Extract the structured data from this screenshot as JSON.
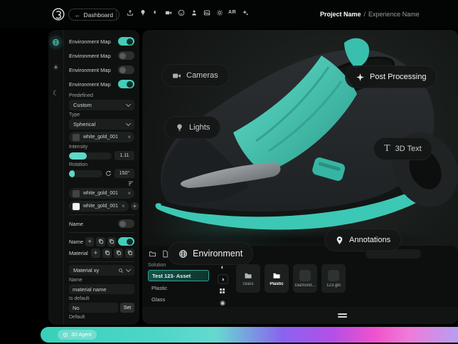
{
  "theme": {
    "accent": "#45cdb9",
    "bar_teal": "#38d0ba",
    "bar_purple": "#8a63f0",
    "bar_magenta": "#ef52cc",
    "bar_lavender": "#b79ef2"
  },
  "topbar": {
    "back": "←",
    "dashboard": "Dashboard",
    "icons": [
      "upload",
      "light-bulb",
      "contrast",
      "video-camera",
      "face",
      "person-pin",
      "image",
      "settings-gear",
      "ar",
      "magic-avatar"
    ],
    "ar_label": "AR",
    "project_name": "Project Name",
    "separator": "/",
    "experience_name": "Experience Name"
  },
  "sidebar": {
    "rail": [
      "globe",
      "sun",
      "moon"
    ],
    "env_toggles": [
      {
        "label": "Environment Map",
        "on": true
      },
      {
        "label": "Environment Map",
        "on": false
      },
      {
        "label": "Environment Map",
        "on": false
      },
      {
        "label": "Environment Map",
        "on": true
      }
    ],
    "predefined": {
      "label": "Predefined",
      "value": "Custom"
    },
    "type": {
      "label": "Type",
      "value": "Spherical"
    },
    "map_slot": {
      "name": "white_gold_001",
      "remove": "×"
    },
    "intensity": {
      "label": "Intensity",
      "value": "1.11",
      "pct": 42
    },
    "rotation": {
      "label": "Rotation",
      "value": "150°",
      "pct": 18
    },
    "map_items": [
      {
        "name": "white_gold_001",
        "remove": "×"
      },
      {
        "name": "white_gold_001",
        "remove": "×",
        "add": "+"
      }
    ],
    "name_toggle": {
      "label": "Name",
      "on": false
    },
    "name_row": {
      "label": "Name",
      "add": "+",
      "on": true
    },
    "material_row": {
      "label": "Material",
      "add": "+"
    },
    "material_select": {
      "value": "Material xy"
    },
    "material_name": {
      "label": "Name",
      "value": "material name"
    },
    "is_default": {
      "label": "Is default",
      "value": "No",
      "button": "Set"
    },
    "default_label": "Default"
  },
  "viewport": {
    "pills": [
      {
        "label": "Cameras",
        "icon": "video-camera"
      },
      {
        "label": "Post Processing",
        "icon": "sparkle"
      },
      {
        "label": "Lights",
        "icon": "light-bulb"
      },
      {
        "label": "3D Text",
        "icon": "serif-T"
      },
      {
        "label": "Annotations",
        "icon": "location-pin"
      },
      {
        "label": "Environment",
        "icon": "globe"
      }
    ]
  },
  "assets": {
    "toolbar_icons": [
      "folder",
      "file"
    ],
    "list": {
      "header": "Solution",
      "items": [
        "Test 123- Asset",
        "Plastic",
        "Glass"
      ],
      "selected": "Test 123- Asset"
    },
    "rail_icons": [
      "contrast-left",
      "contrast-right",
      "grid",
      "sphere"
    ],
    "cards": [
      {
        "label": "Glass",
        "icon": "folder",
        "selected": false
      },
      {
        "label": "Plastic",
        "icon": "folder",
        "selected": true
      },
      {
        "label": "Diamond...",
        "icon": "sphere",
        "selected": false
      },
      {
        "label": "123.glb",
        "icon": "sphere",
        "selected": false
      }
    ]
  },
  "agent_bar": {
    "label": "3D Agent"
  }
}
